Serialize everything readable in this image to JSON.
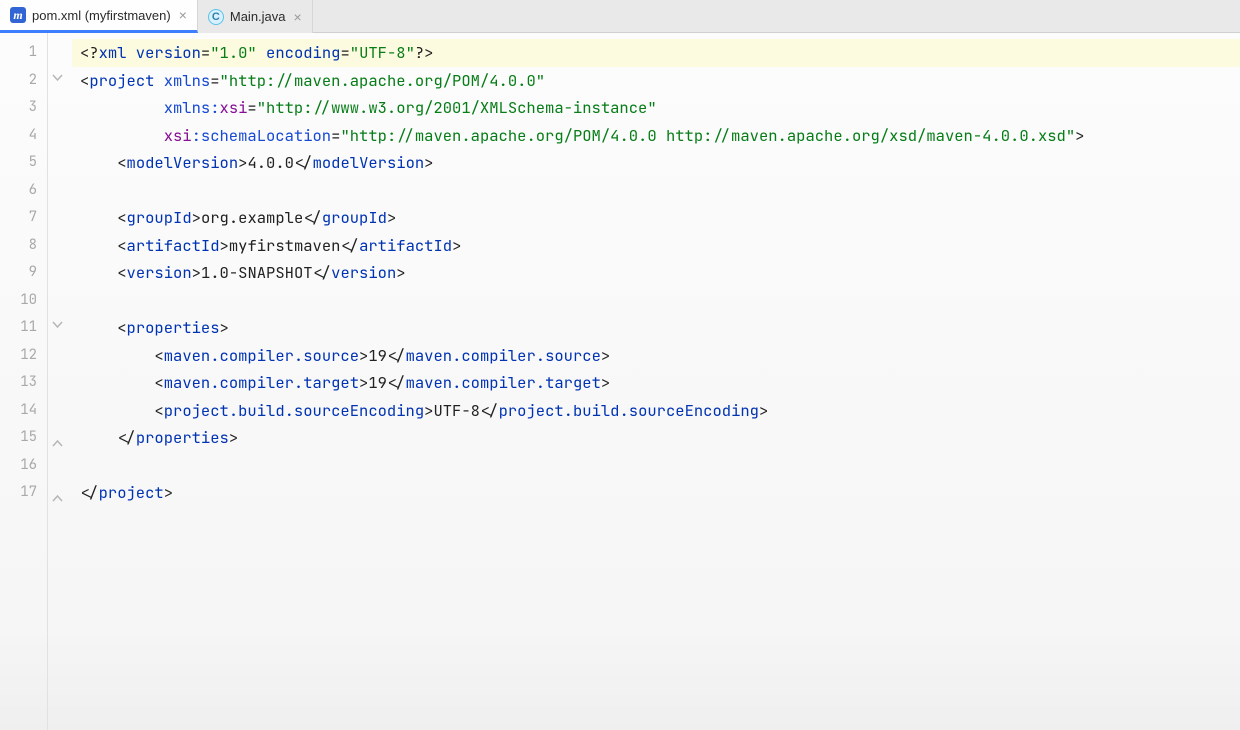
{
  "tabs": [
    {
      "icon": "ic-maven",
      "iconLetter": "m",
      "label": "pom.xml (myfirstmaven)",
      "active": true
    },
    {
      "icon": "ic-java",
      "iconLetter": "C",
      "label": "Main.java",
      "active": false
    }
  ],
  "lineCount": 17,
  "currentLine": 1,
  "foldHandles": [
    {
      "line": 2,
      "state": "open"
    },
    {
      "line": 11,
      "state": "open"
    },
    {
      "line": 15,
      "state": "close"
    },
    {
      "line": 17,
      "state": "close"
    }
  ],
  "code": [
    [
      {
        "c": "t-punc",
        "t": "<?"
      },
      {
        "c": "t-xmlkey",
        "t": "xml version"
      },
      {
        "c": "t-punc",
        "t": "="
      },
      {
        "c": "t-str",
        "t": "\"1.0\""
      },
      {
        "c": "t-xmlkey",
        "t": " encoding"
      },
      {
        "c": "t-punc",
        "t": "="
      },
      {
        "c": "t-str",
        "t": "\"UTF-8\""
      },
      {
        "c": "t-punc",
        "t": "?>"
      }
    ],
    [
      {
        "c": "t-punc",
        "t": "<"
      },
      {
        "c": "t-tag",
        "t": "project "
      },
      {
        "c": "t-attr",
        "t": "xmlns"
      },
      {
        "c": "t-punc",
        "t": "="
      },
      {
        "c": "t-str",
        "t": "\"http://maven.apache.org/POM/4.0.0\""
      }
    ],
    [
      {
        "c": "t-text",
        "t": "         "
      },
      {
        "c": "t-attr",
        "t": "xmlns:"
      },
      {
        "c": "t-ns",
        "t": "xsi"
      },
      {
        "c": "t-punc",
        "t": "="
      },
      {
        "c": "t-str",
        "t": "\"http://www.w3.org/2001/XMLSchema-instance\""
      }
    ],
    [
      {
        "c": "t-text",
        "t": "         "
      },
      {
        "c": "t-ns",
        "t": "xsi"
      },
      {
        "c": "t-attr",
        "t": ":schemaLocation"
      },
      {
        "c": "t-punc",
        "t": "="
      },
      {
        "c": "t-str",
        "t": "\"http://maven.apache.org/POM/4.0.0 http://maven.apache.org/xsd/maven-4.0.0.xsd\""
      },
      {
        "c": "t-punc",
        "t": ">"
      }
    ],
    [
      {
        "c": "t-text",
        "t": "    "
      },
      {
        "c": "t-punc",
        "t": "<"
      },
      {
        "c": "t-tag",
        "t": "modelVersion"
      },
      {
        "c": "t-punc",
        "t": ">"
      },
      {
        "c": "t-text",
        "t": "4.0.0"
      },
      {
        "c": "t-punc",
        "t": "</"
      },
      {
        "c": "t-tag",
        "t": "modelVersion"
      },
      {
        "c": "t-punc",
        "t": ">"
      }
    ],
    [],
    [
      {
        "c": "t-text",
        "t": "    "
      },
      {
        "c": "t-punc",
        "t": "<"
      },
      {
        "c": "t-tag",
        "t": "groupId"
      },
      {
        "c": "t-punc",
        "t": ">"
      },
      {
        "c": "t-text",
        "t": "org.example"
      },
      {
        "c": "t-punc",
        "t": "</"
      },
      {
        "c": "t-tag",
        "t": "groupId"
      },
      {
        "c": "t-punc",
        "t": ">"
      }
    ],
    [
      {
        "c": "t-text",
        "t": "    "
      },
      {
        "c": "t-punc",
        "t": "<"
      },
      {
        "c": "t-tag",
        "t": "artifactId"
      },
      {
        "c": "t-punc",
        "t": ">"
      },
      {
        "c": "t-text",
        "t": "myfirstmaven"
      },
      {
        "c": "t-punc",
        "t": "</"
      },
      {
        "c": "t-tag",
        "t": "artifactId"
      },
      {
        "c": "t-punc",
        "t": ">"
      }
    ],
    [
      {
        "c": "t-text",
        "t": "    "
      },
      {
        "c": "t-punc",
        "t": "<"
      },
      {
        "c": "t-tag",
        "t": "version"
      },
      {
        "c": "t-punc",
        "t": ">"
      },
      {
        "c": "t-text",
        "t": "1.0-SNAPSHOT"
      },
      {
        "c": "t-punc",
        "t": "</"
      },
      {
        "c": "t-tag",
        "t": "version"
      },
      {
        "c": "t-punc",
        "t": ">"
      }
    ],
    [],
    [
      {
        "c": "t-text",
        "t": "    "
      },
      {
        "c": "t-punc",
        "t": "<"
      },
      {
        "c": "t-tag",
        "t": "properties"
      },
      {
        "c": "t-punc",
        "t": ">"
      }
    ],
    [
      {
        "c": "t-text",
        "t": "        "
      },
      {
        "c": "t-punc",
        "t": "<"
      },
      {
        "c": "t-tag",
        "t": "maven.compiler.source"
      },
      {
        "c": "t-punc",
        "t": ">"
      },
      {
        "c": "t-text",
        "t": "19"
      },
      {
        "c": "t-punc",
        "t": "</"
      },
      {
        "c": "t-tag",
        "t": "maven.compiler.source"
      },
      {
        "c": "t-punc",
        "t": ">"
      }
    ],
    [
      {
        "c": "t-text",
        "t": "        "
      },
      {
        "c": "t-punc",
        "t": "<"
      },
      {
        "c": "t-tag",
        "t": "maven.compiler.target"
      },
      {
        "c": "t-punc",
        "t": ">"
      },
      {
        "c": "t-text",
        "t": "19"
      },
      {
        "c": "t-punc",
        "t": "</"
      },
      {
        "c": "t-tag",
        "t": "maven.compiler.target"
      },
      {
        "c": "t-punc",
        "t": ">"
      }
    ],
    [
      {
        "c": "t-text",
        "t": "        "
      },
      {
        "c": "t-punc",
        "t": "<"
      },
      {
        "c": "t-tag",
        "t": "project.build.sourceEncoding"
      },
      {
        "c": "t-punc",
        "t": ">"
      },
      {
        "c": "t-text",
        "t": "UTF-8"
      },
      {
        "c": "t-punc",
        "t": "</"
      },
      {
        "c": "t-tag",
        "t": "project.build.sourceEncoding"
      },
      {
        "c": "t-punc",
        "t": ">"
      }
    ],
    [
      {
        "c": "t-text",
        "t": "    "
      },
      {
        "c": "t-punc",
        "t": "</"
      },
      {
        "c": "t-tag",
        "t": "properties"
      },
      {
        "c": "t-punc",
        "t": ">"
      }
    ],
    [],
    [
      {
        "c": "t-punc",
        "t": "</"
      },
      {
        "c": "t-tag",
        "t": "project"
      },
      {
        "c": "t-punc",
        "t": ">"
      }
    ]
  ]
}
